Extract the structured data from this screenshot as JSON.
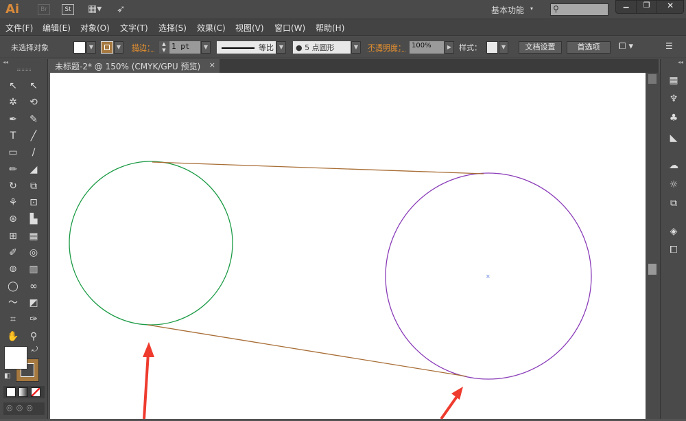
{
  "app": {
    "logo": "Ai",
    "bridge": "Br",
    "stock": "St",
    "workspace": "基本功能",
    "search_placeholder": ""
  },
  "window": {
    "minimize": "▁",
    "restore": "❐",
    "close": "✕"
  },
  "menu": [
    "文件(F)",
    "编辑(E)",
    "对象(O)",
    "文字(T)",
    "选择(S)",
    "效果(C)",
    "视图(V)",
    "窗口(W)",
    "帮助(H)"
  ],
  "control": {
    "selection": "未选择对象",
    "stroke_label": "描边：",
    "stroke_weight": "1 pt",
    "stroke_profile": "等比",
    "brush": "5 点圆形",
    "opacity_label": "不透明度：",
    "opacity": "100%",
    "style_label": "样式：",
    "doc_setup": "文档设置",
    "prefs": "首选项"
  },
  "document": {
    "tab": "未标题-2* @ 150% (CMYK/GPU 预览)",
    "close": "×"
  },
  "tools": [
    [
      "↖",
      "↖"
    ],
    [
      "✲",
      "⟲"
    ],
    [
      "✒",
      "✎"
    ],
    [
      "T",
      "╱"
    ],
    [
      "▭",
      "∕"
    ],
    [
      "✏",
      "◢"
    ],
    [
      "↻",
      "⧉"
    ],
    [
      "⚘",
      "⊡"
    ],
    [
      "⊛",
      "▙"
    ],
    [
      "⊞",
      "▦"
    ],
    [
      "✐",
      "◎"
    ],
    [
      "⊚",
      "▥"
    ],
    [
      "◯",
      "∞"
    ],
    [
      "〜",
      "◩"
    ],
    [
      "⌗",
      "✑"
    ],
    [
      "✋",
      "⚲"
    ]
  ],
  "colors": {
    "fill": "#ffffff",
    "stroke": "#a5793f",
    "circle1": "#1a9a44",
    "circle2": "#8a3cb8",
    "lines": "#a86d35",
    "arrow": "#ee3b2e"
  },
  "right_panel": [
    "▦",
    "♆",
    "♣",
    "◣",
    "☁",
    "☼",
    "⧉",
    "◈",
    "⧠"
  ]
}
